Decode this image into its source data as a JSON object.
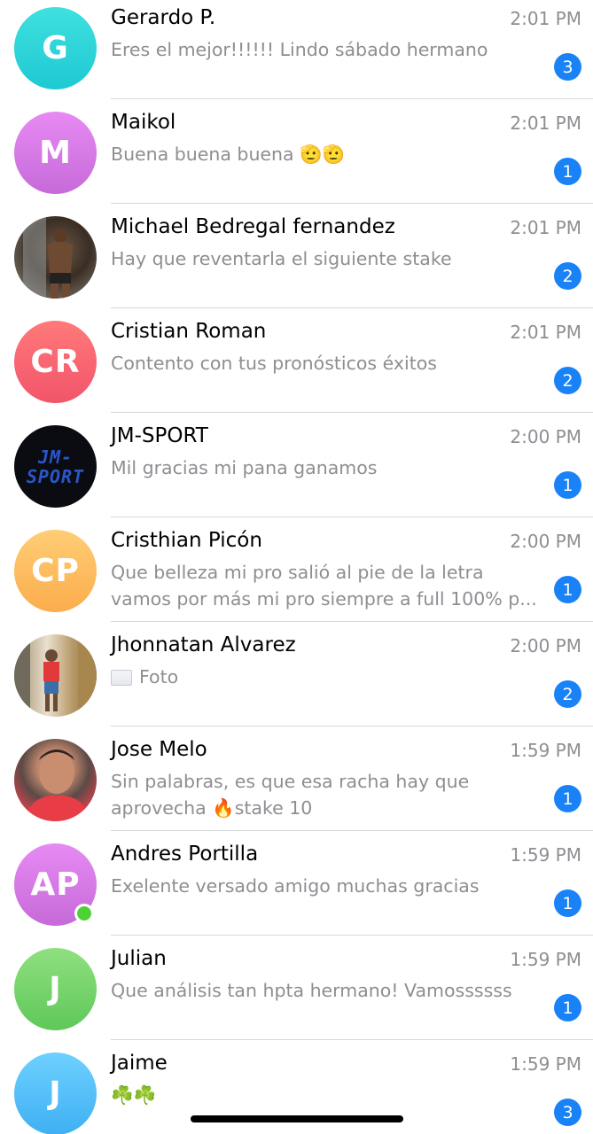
{
  "chats": [
    {
      "avatar_text": "G",
      "avatar_color": "cyan",
      "name": "Gerardo P.",
      "time": "2:01 PM",
      "message": "Eres el mejor!!!!!! Lindo sábado hermano",
      "unread": "3"
    },
    {
      "avatar_text": "M",
      "avatar_color": "violet",
      "name": "Maikol",
      "time": "2:01 PM",
      "message": "Buena buena buena 🫡🫡",
      "unread": "1"
    },
    {
      "avatar_text": "",
      "avatar_color": "photo",
      "name": "Michael Bedregal fernandez",
      "time": "2:01 PM",
      "message": "Hay que reventarla el siguiente stake",
      "unread": "2"
    },
    {
      "avatar_text": "CR",
      "avatar_color": "red",
      "name": "Cristian Roman",
      "time": "2:01 PM",
      "message": "Contento con tus pronósticos éxitos",
      "unread": "2"
    },
    {
      "avatar_text": "JM-SPORT",
      "avatar_color": "photo",
      "name": "JM-SPORT",
      "time": "2:00 PM",
      "message": "Mil gracias mi pana ganamos",
      "unread": "1"
    },
    {
      "avatar_text": "CP",
      "avatar_color": "orange",
      "name": "Cristhian Picón",
      "time": "2:00 PM",
      "message": "Que belleza mi pro salió al pie de la letra vamos por más mi pro siempre a full 100% p...",
      "unread": "1"
    },
    {
      "avatar_text": "",
      "avatar_color": "photo",
      "name": "Jhonnatan Alvarez",
      "time": "2:00 PM",
      "message": "Foto",
      "unread": "2"
    },
    {
      "avatar_text": "",
      "avatar_color": "photo",
      "name": "Jose Melo",
      "time": "1:59 PM",
      "message": "Sin palabras, es que esa racha hay que aprovecha 🔥stake 10",
      "unread": "1"
    },
    {
      "avatar_text": "AP",
      "avatar_color": "violet",
      "name": "Andres Portilla",
      "time": "1:59 PM",
      "message": "Exelente versado amigo muchas gracias",
      "unread": "1"
    },
    {
      "avatar_text": "J",
      "avatar_color": "green",
      "name": "Julian",
      "time": "1:59 PM",
      "message": "Que análisis tan hpta hermano! Vamossssss",
      "unread": "1"
    },
    {
      "avatar_text": "J",
      "avatar_color": "blue",
      "name": "Jaime",
      "time": "1:59 PM",
      "message": "☘️☘️",
      "unread": "3"
    }
  ],
  "accent_color": "#1a82f7",
  "online_color": "#4cd137"
}
